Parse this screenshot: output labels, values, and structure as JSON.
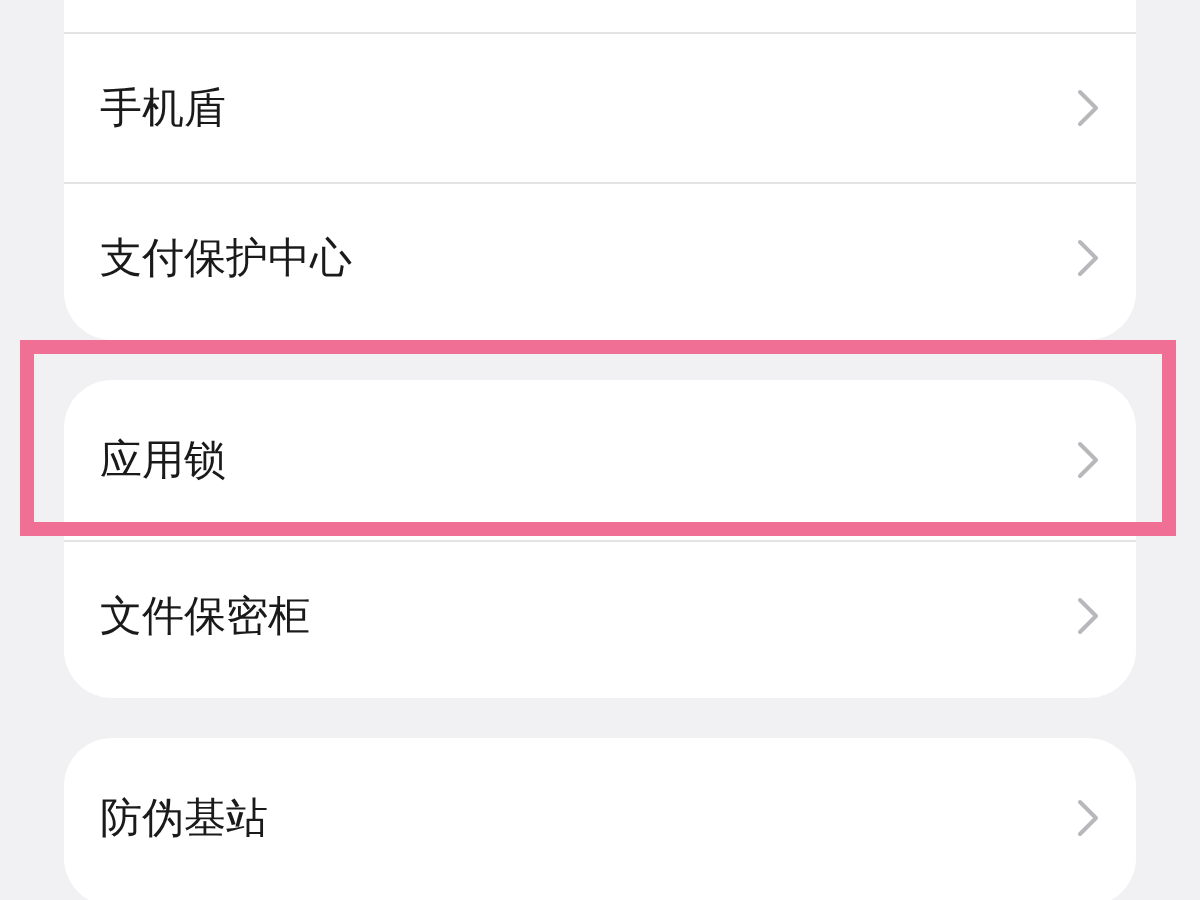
{
  "sections": [
    {
      "cut_top": true,
      "items": [
        {
          "label": "手机盾",
          "highlighted": false
        },
        {
          "label": "支付保护中心",
          "highlighted": false
        }
      ]
    },
    {
      "cut_top": false,
      "items": [
        {
          "label": "应用锁",
          "highlighted": true
        },
        {
          "label": "文件保密柜",
          "highlighted": false
        }
      ]
    },
    {
      "cut_top": false,
      "items": [
        {
          "label": "防伪基站",
          "highlighted": false
        }
      ]
    }
  ]
}
